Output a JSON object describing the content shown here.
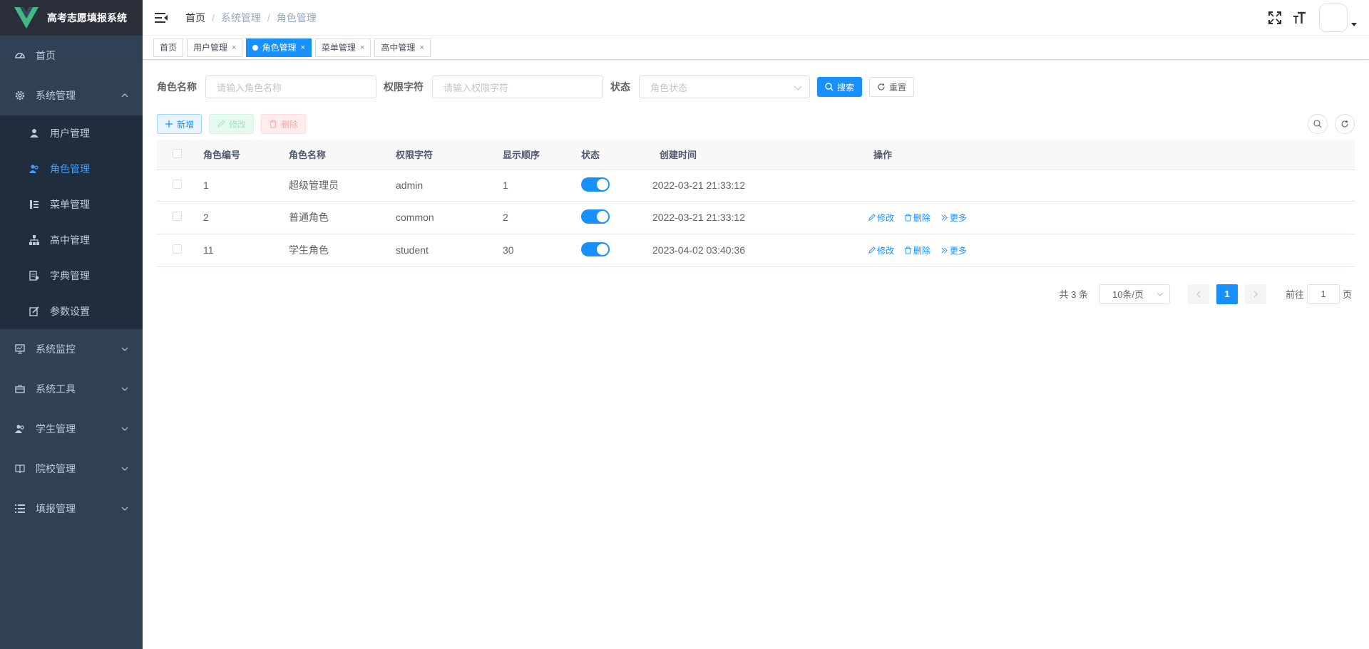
{
  "app": {
    "title": "高考志愿填报系统",
    "accent": "#1890ff",
    "sidebar_bg": "#304156"
  },
  "sidebar": {
    "home": "首页",
    "system": "系统管理",
    "sub": [
      "用户管理",
      "角色管理",
      "菜单管理",
      "高中管理",
      "字典管理",
      "参数设置"
    ],
    "groups": [
      "系统监控",
      "系统工具",
      "学生管理",
      "院校管理",
      "填报管理"
    ]
  },
  "breadcrumb": [
    "首页",
    "系统管理",
    "角色管理"
  ],
  "tags": [
    "首页",
    "用户管理",
    "角色管理",
    "菜单管理",
    "高中管理"
  ],
  "query": {
    "role_name_label": "角色名称",
    "role_name_placeholder": "请输入角色名称",
    "perm_label": "权限字符",
    "perm_placeholder": "请输入权限字符",
    "status_label": "状态",
    "status_placeholder": "角色状态",
    "search": "搜索",
    "reset": "重置"
  },
  "toolbar": {
    "add": "新增",
    "edit": "修改",
    "delete": "删除"
  },
  "table": {
    "headers": [
      "角色编号",
      "角色名称",
      "权限字符",
      "显示顺序",
      "状态",
      "创建时间",
      "操作"
    ],
    "rows": [
      {
        "id": "1",
        "name": "超级管理员",
        "key": "admin",
        "sort": "1",
        "time": "2022-03-21 21:33:12",
        "status_on": true
      },
      {
        "id": "2",
        "name": "普通角色",
        "key": "common",
        "sort": "2",
        "time": "2022-03-21 21:33:12",
        "status_on": true
      },
      {
        "id": "11",
        "name": "学生角色",
        "key": "student",
        "sort": "30",
        "time": "2023-04-02 03:40:36",
        "status_on": true
      }
    ],
    "ops": {
      "edit": "修改",
      "delete": "删除",
      "more": "更多"
    }
  },
  "pager": {
    "total": "共 3 条",
    "size": "10条/页",
    "current": "1",
    "goto": "前往",
    "goto_value": "1",
    "page_suffix": "页"
  }
}
